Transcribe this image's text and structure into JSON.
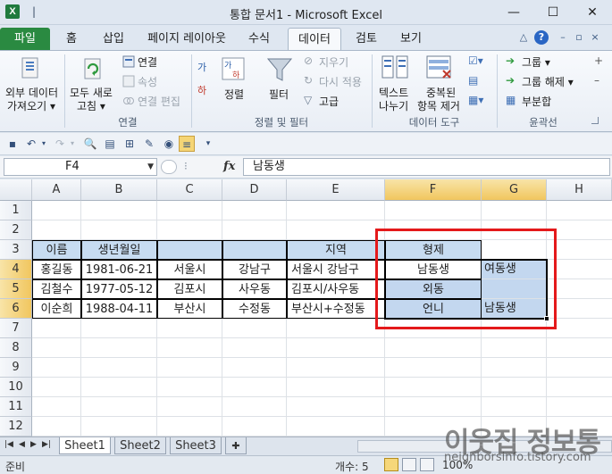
{
  "window": {
    "title": "통합 문서1 - Microsoft Excel",
    "app_icon": "X",
    "minimize": "—",
    "maximize": "☐",
    "close": "✕"
  },
  "ribbon_tabs": [
    "파일",
    "홈",
    "삽입",
    "페이지 레이아웃",
    "수식",
    "데이터",
    "검토",
    "보기"
  ],
  "ribbon": {
    "external_data": {
      "line1": "외부 데이터",
      "line2": "가져오기 ▾"
    },
    "refresh_all": {
      "line1": "모두 새로",
      "line2": "고침 ▾"
    },
    "connections": "연결",
    "properties": "속성",
    "edit_links": "연결 편집",
    "connections_group": "연결",
    "sort": "정렬",
    "filter": "필터",
    "clear": "지우기",
    "reapply": "다시 적용",
    "advanced": "고급",
    "sort_filter_group": "정렬 및 필터",
    "text_to_columns": {
      "line1": "텍스트",
      "line2": "나누기"
    },
    "remove_duplicates": {
      "line1": "중복된",
      "line2": "항목 제거"
    },
    "data_tools_group": "데이터 도구",
    "group": "그룹 ▾",
    "ungroup": "그룹 해제 ▾",
    "subtotal": "부분합",
    "outline_group": "윤곽선"
  },
  "formula_bar": {
    "name_box": "F4",
    "fx": "fx",
    "value": "남동생"
  },
  "columns": [
    "A",
    "B",
    "C",
    "D",
    "E",
    "F",
    "G",
    "H"
  ],
  "rows": [
    "1",
    "2",
    "3",
    "4",
    "5",
    "6",
    "7",
    "8",
    "9",
    "10",
    "11",
    "12"
  ],
  "cells": {
    "A3": "이름",
    "B3": "생년월일",
    "E3": "지역",
    "F3": "형제",
    "A4": "홍길동",
    "B4": "1981-06-21",
    "C4": "서울시",
    "D4": "강남구",
    "E4": "서울시 강남구",
    "F4": "남동생",
    "G4": "여동생",
    "A5": "김철수",
    "B5": "1977-05-12",
    "C5": "김포시",
    "D5": "사우동",
    "E5": "김포시/사우동",
    "F5": "외동",
    "A6": "이순희",
    "B6": "1988-04-11",
    "C6": "부산시",
    "D6": "수정동",
    "E6": "부산시+수정동",
    "F6": "언니",
    "G6": "남동생"
  },
  "sheets": [
    "Sheet1",
    "Sheet2",
    "Sheet3"
  ],
  "status": {
    "ready": "준비",
    "count": "개수: 5",
    "zoom": "100%"
  },
  "watermark": {
    "text": "이웃집 정보통",
    "url": "neighborsinfo.tistory.com"
  },
  "colors": {
    "accent_red": "#e4191b",
    "selection": "#c3d7ef",
    "header_fill": "#c7dcf1",
    "file_tab": "#2a8a41"
  }
}
